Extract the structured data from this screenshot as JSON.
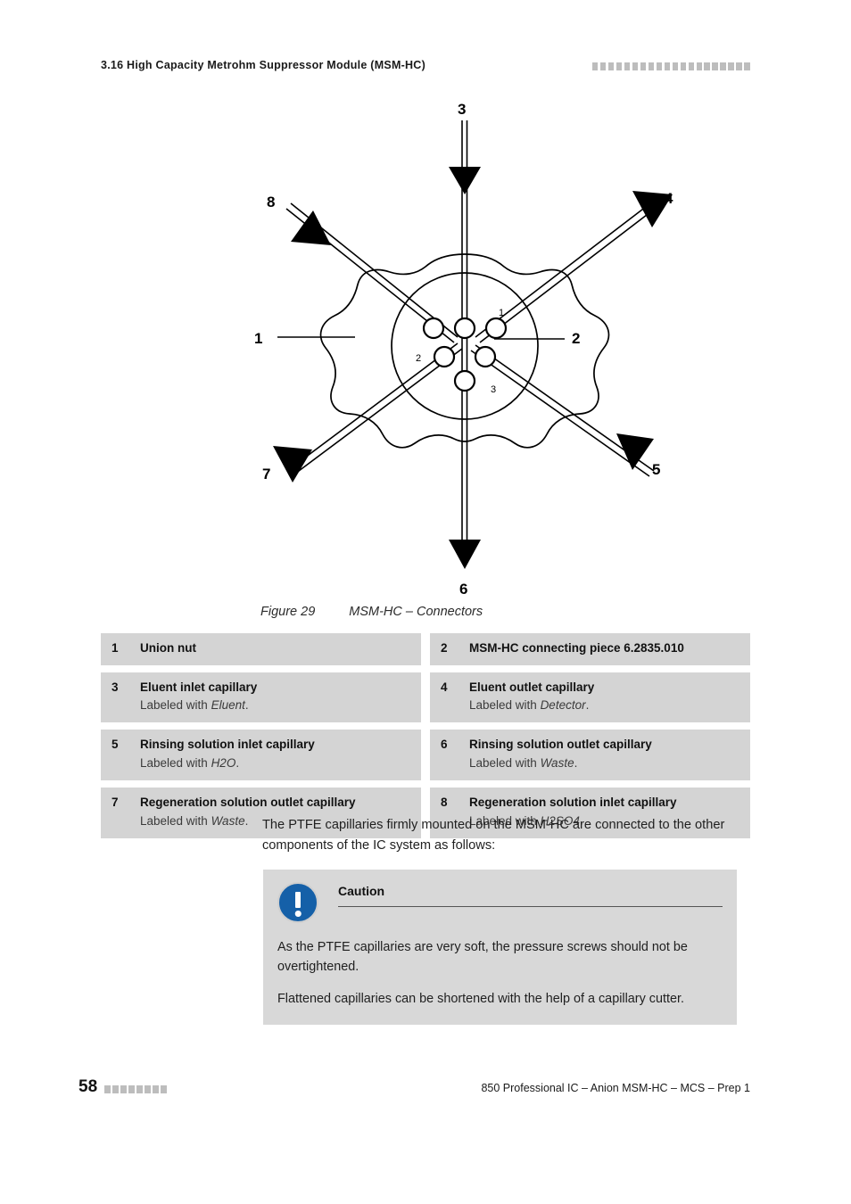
{
  "header": {
    "section_title": "3.16 High Capacity Metrohm Suppressor Module (MSM-HC)",
    "decoration_squares": 20
  },
  "figure": {
    "caption_number": "Figure 29",
    "caption_text": "MSM-HC – Connectors",
    "callouts": {
      "c1": "1",
      "c2": "2",
      "c3": "3",
      "c4": "4",
      "c5": "5",
      "c6": "6",
      "c7": "7",
      "c8": "8"
    },
    "port_labels": {
      "p1": "1",
      "p2": "2",
      "p3": "3"
    }
  },
  "legend": {
    "items": [
      {
        "num": "1",
        "title": "Union nut",
        "sub_prefix": "",
        "sub_italic": "",
        "sub_suffix": ""
      },
      {
        "num": "2",
        "title": "MSM-HC connecting piece 6.2835.010",
        "sub_prefix": "",
        "sub_italic": "",
        "sub_suffix": ""
      },
      {
        "num": "3",
        "title": "Eluent inlet capillary",
        "sub_prefix": "Labeled with ",
        "sub_italic": "Eluent",
        "sub_suffix": "."
      },
      {
        "num": "4",
        "title": "Eluent outlet capillary",
        "sub_prefix": "Labeled with ",
        "sub_italic": "Detector",
        "sub_suffix": "."
      },
      {
        "num": "5",
        "title": "Rinsing solution inlet capillary",
        "sub_prefix": "Labeled with ",
        "sub_italic": "H2O",
        "sub_suffix": "."
      },
      {
        "num": "6",
        "title": "Rinsing solution outlet capillary",
        "sub_prefix": "Labeled with ",
        "sub_italic": "Waste",
        "sub_suffix": "."
      },
      {
        "num": "7",
        "title": "Regeneration solution outlet capillary",
        "sub_prefix": "Labeled with ",
        "sub_italic": "Waste",
        "sub_suffix": "."
      },
      {
        "num": "8",
        "title": "Regeneration solution inlet capillary",
        "sub_prefix": "Labeled with ",
        "sub_italic": "H2SO4",
        "sub_suffix": "."
      }
    ]
  },
  "body": {
    "paragraph": "The PTFE capillaries firmly mounted on the MSM-HC are connected to the other components of the IC system as follows:"
  },
  "caution": {
    "icon_name": "exclamation-icon",
    "icon_color": "#1560a8",
    "title": "Caution",
    "paragraph_1": "As the PTFE capillaries are very soft, the pressure screws should not be overtightened.",
    "paragraph_2": "Flattened capillaries can be shortened with the help of a capillary cutter."
  },
  "footer": {
    "page_number": "58",
    "decoration_squares": 8,
    "document_title": "850 Professional IC – Anion MSM-HC – MCS – Prep 1"
  },
  "colors": {
    "legend_row_bg": "#d4d4d4",
    "caution_bg": "#d8d8d8",
    "square_gray": "#bdbdbd",
    "ink": "#1a1a1a"
  }
}
